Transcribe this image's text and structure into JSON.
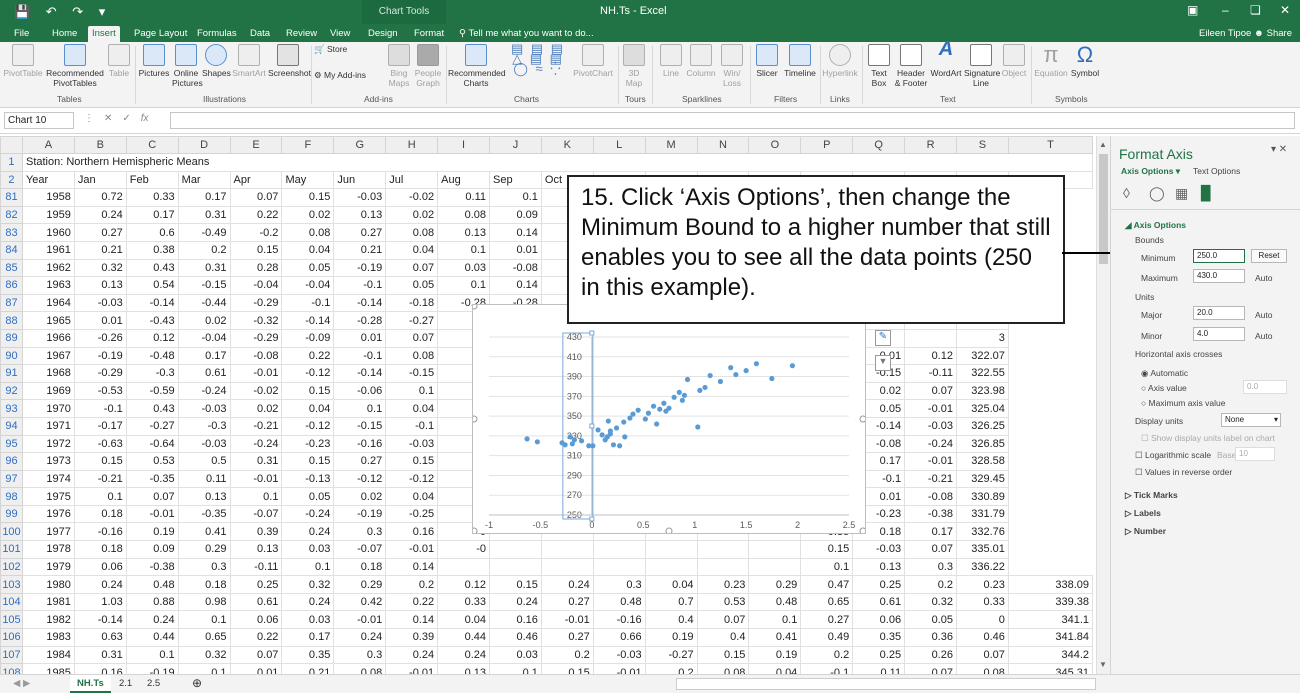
{
  "window": {
    "title": "NH.Ts - Excel",
    "context_tab": "Chart Tools"
  },
  "tabs": [
    "File",
    "Home",
    "Insert",
    "Page Layout",
    "Formulas",
    "Data",
    "Review",
    "View",
    "Design",
    "Format"
  ],
  "tell_me": "Tell me what you want to do...",
  "user": {
    "name": "Eileen Tipoe",
    "share": "Share"
  },
  "ribbon": {
    "buttons": [
      "PivotTable",
      "Recommended PivotTables",
      "Table",
      "Pictures",
      "Online Pictures",
      "Shapes",
      "SmartArt",
      "Screenshot",
      "Store",
      "My Add-ins",
      "Bing Maps",
      "People Graph",
      "Recommended Charts",
      "PivotChart",
      "3D Map",
      "Line",
      "Column",
      "Win/ Loss",
      "Slicer",
      "Timeline",
      "Hyperlink",
      "Text Box",
      "Header & Footer",
      "WordArt",
      "Signature Line",
      "Object",
      "Equation",
      "Symbol"
    ],
    "groups": [
      "Tables",
      "Illustrations",
      "Add-ins",
      "Charts",
      "Tours",
      "Sparklines",
      "Filters",
      "Links",
      "Text",
      "Symbols"
    ]
  },
  "formula_bar": {
    "name_box": "Chart 10",
    "fx": "fx",
    "value": ""
  },
  "sheet": {
    "columns": [
      "A",
      "B",
      "C",
      "D",
      "E",
      "F",
      "G",
      "H",
      "I",
      "J",
      "K",
      "L",
      "M",
      "N",
      "O",
      "P",
      "Q",
      "R",
      "S",
      "T"
    ],
    "row1": {
      "num": "1",
      "text": "Station: Northern Hemispheric Means"
    },
    "row2": {
      "num": "2",
      "headers": [
        "Year",
        "Jan",
        "Feb",
        "Mar",
        "Apr",
        "May",
        "Jun",
        "Jul",
        "Aug",
        "Sep",
        "Oct",
        "",
        "",
        "",
        "",
        "",
        "",
        "",
        "",
        "data"
      ]
    },
    "rows": [
      [
        "81",
        "1958",
        "0.72",
        "0.33",
        "0.17",
        "0.07",
        "0.15",
        "-0.03",
        "-0.02",
        "0.11",
        "0.1",
        "",
        "",
        "",
        "",
        "",
        "",
        "",
        "",
        ""
      ],
      [
        "82",
        "1959",
        "0.24",
        "0.17",
        "0.31",
        "0.22",
        "0.02",
        "0.13",
        "0.02",
        "0.08",
        "0.09",
        "",
        "",
        "",
        "",
        "",
        "",
        "",
        "",
        "7"
      ],
      [
        "83",
        "1960",
        "0.27",
        "0.6",
        "-0.49",
        "-0.2",
        "0.08",
        "0.27",
        "0.08",
        "0.13",
        "0.14",
        "",
        "",
        "",
        "",
        "",
        "",
        "",
        "",
        "1"
      ],
      [
        "84",
        "1961",
        "0.21",
        "0.38",
        "0.2",
        "0.15",
        "0.04",
        "0.21",
        "0.04",
        "0.1",
        "0.01",
        "",
        "",
        "",
        "",
        "",
        "",
        "",
        "",
        "3"
      ],
      [
        "85",
        "1962",
        "0.32",
        "0.43",
        "0.31",
        "0.28",
        "0.05",
        "-0.19",
        "0.07",
        "0.03",
        "-0.08",
        "",
        "",
        "",
        "",
        "",
        "",
        "",
        "",
        "6"
      ],
      [
        "86",
        "1963",
        "0.13",
        "0.54",
        "-0.15",
        "-0.04",
        "-0.04",
        "-0.1",
        "0.05",
        "0.1",
        "0.14",
        "",
        "",
        "",
        "",
        "",
        "",
        "",
        "",
        "1"
      ],
      [
        "87",
        "1964",
        "-0.03",
        "-0.14",
        "-0.44",
        "-0.29",
        "-0.1",
        "-0.14",
        "-0.18",
        "-0.28",
        "-0.28",
        "",
        "",
        "",
        "",
        "",
        "",
        "",
        "",
        "5"
      ],
      [
        "88",
        "1965",
        "0.01",
        "-0.43",
        "0.02",
        "-0.32",
        "-0.14",
        "-0.28",
        "-0.27",
        "-0",
        "",
        "",
        "",
        "",
        "",
        "",
        "",
        "",
        "",
        "8"
      ],
      [
        "89",
        "1966",
        "-0.26",
        "0.12",
        "-0.04",
        "-0.29",
        "-0.09",
        "0.01",
        "0.07",
        "-0",
        "",
        "",
        "",
        "",
        "",
        "",
        "",
        "",
        "",
        "3"
      ],
      [
        "90",
        "1967",
        "-0.19",
        "-0.48",
        "0.17",
        "-0.08",
        "0.22",
        "-0.1",
        "0.08",
        "0",
        "",
        "",
        "",
        "",
        "",
        "",
        "0.1",
        "0.01",
        "0.12",
        "322.07"
      ],
      [
        "91",
        "1968",
        "-0.29",
        "-0.3",
        "0.61",
        "-0.01",
        "-0.12",
        "-0.14",
        "-0.15",
        "-0",
        "",
        "",
        "",
        "",
        "",
        "",
        "0.16",
        "-0.15",
        "-0.11",
        "322.55"
      ],
      [
        "92",
        "1969",
        "-0.53",
        "-0.59",
        "-0.24",
        "-0.02",
        "0.15",
        "-0.06",
        "0.1",
        "0",
        "",
        "",
        "",
        "",
        "",
        "",
        "0.04",
        "0.02",
        "0.07",
        "323.98"
      ],
      [
        "93",
        "1970",
        "-0.1",
        "0.43",
        "-0.03",
        "0.02",
        "0.04",
        "0.1",
        "0.04",
        "-0",
        "",
        "",
        "",
        "",
        "",
        "",
        "0.01",
        "0.05",
        "-0.01",
        "325.04"
      ],
      [
        "94",
        "1971",
        "-0.17",
        "-0.27",
        "-0.3",
        "-0.21",
        "-0.12",
        "-0.15",
        "-0.1",
        "-0",
        "",
        "",
        "",
        "",
        "",
        "",
        "-0.21",
        "-0.14",
        "-0.03",
        "326.25"
      ],
      [
        "95",
        "1972",
        "-0.63",
        "-0.64",
        "-0.03",
        "-0.24",
        "-0.23",
        "-0.16",
        "-0.03",
        "-0",
        "",
        "",
        "",
        "",
        "",
        "",
        "-0.17",
        "-0.08",
        "-0.24",
        "326.85"
      ],
      [
        "96",
        "1973",
        "0.15",
        "0.53",
        "0.5",
        "0.31",
        "0.15",
        "0.27",
        "0.15",
        "",
        "",
        "",
        "",
        "",
        "",
        "",
        "0.32",
        "0.17",
        "-0.01",
        "328.58"
      ],
      [
        "97",
        "1974",
        "-0.21",
        "-0.35",
        "0.11",
        "-0.01",
        "-0.13",
        "-0.12",
        "-0.12",
        "-0",
        "",
        "",
        "",
        "",
        "",
        "",
        "-0.01",
        "-0.1",
        "-0.21",
        "329.45"
      ],
      [
        "98",
        "1975",
        "0.1",
        "0.07",
        "0.13",
        "0.1",
        "0.05",
        "0.02",
        "0.04",
        "-0",
        "",
        "",
        "",
        "",
        "",
        "",
        "0.09",
        "0.01",
        "-0.08",
        "330.89"
      ],
      [
        "99",
        "1976",
        "0.18",
        "-0.01",
        "-0.35",
        "-0.07",
        "-0.24",
        "-0.19",
        "-0.25",
        "-0",
        "",
        "",
        "",
        "",
        "",
        "",
        "-0.22",
        "-0.23",
        "-0.38",
        "331.79"
      ],
      [
        "100",
        "1977",
        "-0.16",
        "0.19",
        "0.41",
        "0.39",
        "0.24",
        "0.3",
        "0.16",
        "0",
        "",
        "",
        "",
        "",
        "",
        "",
        "0.35",
        "0.18",
        "0.17",
        "332.76"
      ],
      [
        "101",
        "1978",
        "0.18",
        "0.09",
        "0.29",
        "0.13",
        "0.03",
        "-0.07",
        "-0.01",
        "-0",
        "",
        "",
        "",
        "",
        "",
        "",
        "0.15",
        "-0.03",
        "0.07",
        "335.01"
      ],
      [
        "102",
        "1979",
        "0.06",
        "-0.38",
        "0.3",
        "-0.11",
        "0.1",
        "0.18",
        "0.14",
        "",
        "",
        "",
        "",
        "",
        "",
        "",
        "0.1",
        "0.13",
        "0.3",
        "336.22"
      ],
      [
        "103",
        "1980",
        "0.24",
        "0.48",
        "0.18",
        "0.25",
        "0.32",
        "0.29",
        "0.2",
        "0.12",
        "0.15",
        "0.24",
        "0.3",
        "0.04",
        "0.23",
        "0.29",
        "0.47",
        "0.25",
        "0.2",
        "0.23",
        "338.09"
      ],
      [
        "104",
        "1981",
        "1.03",
        "0.88",
        "0.98",
        "0.61",
        "0.24",
        "0.42",
        "0.22",
        "0.33",
        "0.24",
        "0.27",
        "0.48",
        "0.7",
        "0.53",
        "0.48",
        "0.65",
        "0.61",
        "0.32",
        "0.33",
        "339.38"
      ],
      [
        "105",
        "1982",
        "-0.14",
        "0.24",
        "0.1",
        "0.06",
        "0.03",
        "-0.01",
        "0.14",
        "0.04",
        "0.16",
        "-0.01",
        "-0.16",
        "0.4",
        "0.07",
        "0.1",
        "0.27",
        "0.06",
        "0.05",
        "0",
        "341.1"
      ],
      [
        "106",
        "1983",
        "0.63",
        "0.44",
        "0.65",
        "0.22",
        "0.17",
        "0.24",
        "0.39",
        "0.44",
        "0.46",
        "0.27",
        "0.66",
        "0.19",
        "0.4",
        "0.41",
        "0.49",
        "0.35",
        "0.36",
        "0.46",
        "341.84"
      ],
      [
        "107",
        "1984",
        "0.31",
        "0.1",
        "0.32",
        "0.07",
        "0.35",
        "0.3",
        "0.24",
        "0.24",
        "0.03",
        "0.2",
        "-0.03",
        "-0.27",
        "0.15",
        "0.19",
        "0.2",
        "0.25",
        "0.26",
        "0.07",
        "344.2"
      ],
      [
        "108",
        "1985",
        "0.16",
        "-0.19",
        "0.1",
        "0.01",
        "0.21",
        "0.08",
        "-0.01",
        "0.13",
        "0.1",
        "0.15",
        "-0.01",
        "0.2",
        "0.08",
        "0.04",
        "-0.1",
        "0.11",
        "0.07",
        "0.08",
        "345.31"
      ],
      [
        "109",
        "1986",
        "0.52",
        "0.44",
        "0.37",
        "0.31",
        "0.27",
        "0.19",
        "0.05",
        "0.14",
        "0.01",
        "0.08",
        "0.04",
        "0.2",
        "0.22",
        "0.22",
        "0.39",
        "0.32",
        "0.13",
        "0.04",
        "346.59"
      ],
      [
        "110",
        "1987",
        "0.37",
        "0.74",
        "0.16",
        "0.25",
        "0.27",
        "0.32",
        "0.46",
        "0.4",
        "0.54",
        "0.3",
        "0.13",
        "0.65",
        "0.38",
        "0.34",
        "0.44",
        "0.23",
        "0.39",
        "0.32",
        "348.47"
      ]
    ]
  },
  "sheet_tabs": [
    "NH.Ts",
    "2.1",
    "2.5"
  ],
  "callout": {
    "text": "15. Click ‘Axis Options’, then change the Minimum Bound to a higher number that still enables you to see all the data points (250 in this example)."
  },
  "format_panel": {
    "title": "Format Axis",
    "tab_axis": "Axis Options",
    "tab_text": "Text Options",
    "section": "Axis Options",
    "bounds": "Bounds",
    "minimum_label": "Minimum",
    "minimum_value": "250.0",
    "reset": "Reset",
    "maximum_label": "Maximum",
    "maximum_value": "430.0",
    "auto": "Auto",
    "units": "Units",
    "major_label": "Major",
    "major_value": "20.0",
    "minor_label": "Minor",
    "minor_value": "4.0",
    "crosses_label": "Horizontal axis crosses",
    "automatic": "Automatic",
    "axis_value": "Axis value",
    "axis_value_num": "0.0",
    "max_axis_value": "Maximum axis value",
    "display_units": "Display units",
    "display_units_value": "None",
    "show_units_label": "Show display units label on chart",
    "log_scale": "Logarithmic scale",
    "base_label": "Base",
    "base_value": "10",
    "reverse": "Values in reverse order",
    "tick_marks": "Tick Marks",
    "labels": "Labels",
    "number": "Number"
  },
  "chart_data": {
    "type": "scatter",
    "x_ticks": [
      "-1",
      "-0.5",
      "0",
      "0.5",
      "1",
      "1.5",
      "2",
      "2.5"
    ],
    "y_ticks": [
      "250",
      "270",
      "290",
      "310",
      "330",
      "350",
      "370",
      "390",
      "410",
      "430"
    ],
    "xlim": [
      -1,
      2.5
    ],
    "ylim": [
      250,
      430
    ],
    "series_color": "#5b9bd5",
    "points": [
      [
        -0.63,
        327
      ],
      [
        -0.53,
        324
      ],
      [
        -0.29,
        323
      ],
      [
        -0.26,
        321
      ],
      [
        -0.21,
        329
      ],
      [
        -0.19,
        322
      ],
      [
        -0.17,
        326
      ],
      [
        -0.1,
        325
      ],
      [
        -0.03,
        320
      ],
      [
        0.01,
        320
      ],
      [
        0.06,
        336
      ],
      [
        0.1,
        331
      ],
      [
        0.13,
        326
      ],
      [
        0.15,
        329
      ],
      [
        0.16,
        345
      ],
      [
        0.18,
        332
      ],
      [
        0.18,
        335
      ],
      [
        0.21,
        321
      ],
      [
        0.24,
        338
      ],
      [
        0.27,
        320
      ],
      [
        0.31,
        344
      ],
      [
        0.32,
        329
      ],
      [
        0.37,
        348
      ],
      [
        0.4,
        352
      ],
      [
        0.45,
        356
      ],
      [
        0.52,
        347
      ],
      [
        0.55,
        353
      ],
      [
        0.6,
        360
      ],
      [
        0.63,
        342
      ],
      [
        0.66,
        357
      ],
      [
        0.7,
        363
      ],
      [
        0.72,
        355
      ],
      [
        0.75,
        358
      ],
      [
        0.8,
        369
      ],
      [
        0.85,
        374
      ],
      [
        0.88,
        366
      ],
      [
        0.9,
        371
      ],
      [
        0.93,
        387
      ],
      [
        1.03,
        339
      ],
      [
        1.05,
        376
      ],
      [
        1.1,
        379
      ],
      [
        1.15,
        391
      ],
      [
        1.25,
        385
      ],
      [
        1.35,
        399
      ],
      [
        1.4,
        392
      ],
      [
        1.5,
        396
      ],
      [
        1.6,
        403
      ],
      [
        1.75,
        388
      ],
      [
        1.95,
        401
      ]
    ]
  }
}
